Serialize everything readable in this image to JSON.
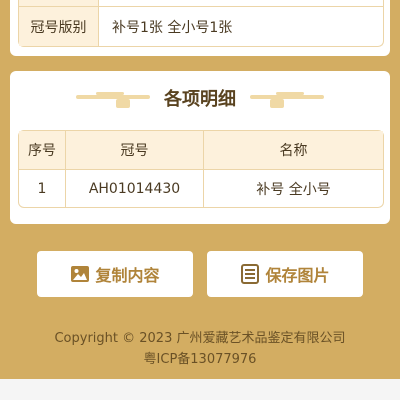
{
  "summary": {
    "rows": [
      {
        "label": "",
        "value": ""
      },
      {
        "label": "冠号版别",
        "value": "补号1张 全小号1张"
      }
    ]
  },
  "details": {
    "title": "各项明细",
    "columns": [
      "序号",
      "冠号",
      "名称"
    ],
    "rows": [
      {
        "index": "1",
        "serial": "AH01014430",
        "name": "补号 全小号"
      }
    ]
  },
  "actions": {
    "copy_label": "复制内容",
    "save_label": "保存图片"
  },
  "footer": {
    "copyright": "Copyright © 2023 广州爱藏艺术品鉴定有限公司",
    "icp": "粤ICP备13077976"
  },
  "colors": {
    "background": "#d3ad62",
    "accent": "#b0843a",
    "header_fill": "#fdf1dc"
  }
}
